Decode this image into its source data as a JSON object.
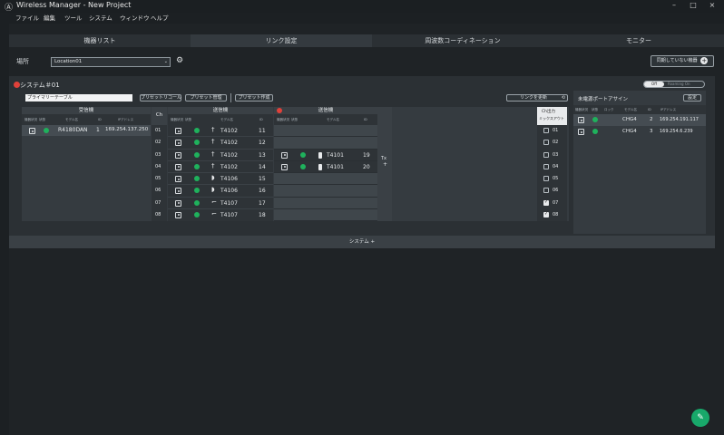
{
  "titlebar": {
    "title": "Wireless Manager - New Project",
    "logo": "Ⓐ",
    "minimize": "–",
    "restore": "□",
    "close": "×"
  },
  "menu": [
    "ファイル",
    "編集",
    "ツール",
    "システム",
    "ウィンドウ",
    "ヘルプ"
  ],
  "tabs": [
    "機器リスト",
    "リンク設定",
    "周波数コーディネーション",
    "モニター"
  ],
  "active_tab": 1,
  "location": {
    "label": "場所",
    "value": "Location01"
  },
  "unlinked_button": "同期していない機器",
  "system": {
    "title": "システム＃01",
    "preset_name": "プライマリーテーブル",
    "preset_recall": "プリセットリコール",
    "preset_manage": "プリセット管理",
    "preset_create": "プリセット作成",
    "link_update": "リンクを更新",
    "toggle_off": "Off",
    "toggle_on": "Roaming On"
  },
  "receiver": {
    "title": "受信機",
    "cols": [
      "機器状況",
      "状態",
      "モデル名",
      "ID",
      "IPアドレス"
    ],
    "row": {
      "model": "R4180DAN",
      "id": "1",
      "ip": "169.254.137.250"
    }
  },
  "ch_header": "Ch",
  "transmitter1": {
    "title": "送信機",
    "cols": [
      "機器状況",
      "状態",
      "モデル名",
      "ID"
    ],
    "rows": [
      {
        "ch": "01",
        "model": "T4102",
        "id": "11",
        "type": "stick"
      },
      {
        "ch": "02",
        "model": "T4102",
        "id": "12",
        "type": "stick"
      },
      {
        "ch": "03",
        "model": "T4102",
        "id": "13",
        "type": "stick"
      },
      {
        "ch": "04",
        "model": "T4102",
        "id": "14",
        "type": "stick"
      },
      {
        "ch": "05",
        "model": "T4106",
        "id": "15",
        "type": "bulb"
      },
      {
        "ch": "06",
        "model": "T4106",
        "id": "16",
        "type": "bulb"
      },
      {
        "ch": "07",
        "model": "T4107",
        "id": "17",
        "type": "head"
      },
      {
        "ch": "08",
        "model": "T4107",
        "id": "18",
        "type": "head"
      }
    ]
  },
  "transmitter2": {
    "title": "送信機",
    "cols": [
      "機器状況",
      "状態",
      "モデル名",
      "ID"
    ],
    "rows": [
      {
        "model": "T4101",
        "id": "19"
      },
      {
        "model": "T4101",
        "id": "20"
      }
    ],
    "tx_label": "Tx",
    "tx_plus": "+"
  },
  "ch_output": {
    "title": "Ch出力",
    "subtitle": "ミックスアウト",
    "rows": [
      {
        "ch": "01",
        "checked": false
      },
      {
        "ch": "02",
        "checked": false
      },
      {
        "ch": "03",
        "checked": false
      },
      {
        "ch": "04",
        "checked": false
      },
      {
        "ch": "05",
        "checked": false
      },
      {
        "ch": "06",
        "checked": false
      },
      {
        "ch": "07",
        "checked": true
      },
      {
        "ch": "08",
        "checked": true
      }
    ]
  },
  "unassigned": {
    "title": "未電源ポートアサイン",
    "settings": "設定",
    "cols": [
      "機器状況",
      "状態",
      "ロック",
      "モデル名",
      "ID",
      "IPアドレス"
    ],
    "rows": [
      {
        "model": "CHG4",
        "id": "2",
        "ip": "169.254.191.117"
      },
      {
        "model": "CHG4",
        "id": "3",
        "ip": "169.254.6.239"
      }
    ]
  },
  "system_footer": "システム +",
  "colors": {
    "accent_green": "#1fb15c",
    "red": "#e0413a",
    "fab": "#18a86a"
  }
}
